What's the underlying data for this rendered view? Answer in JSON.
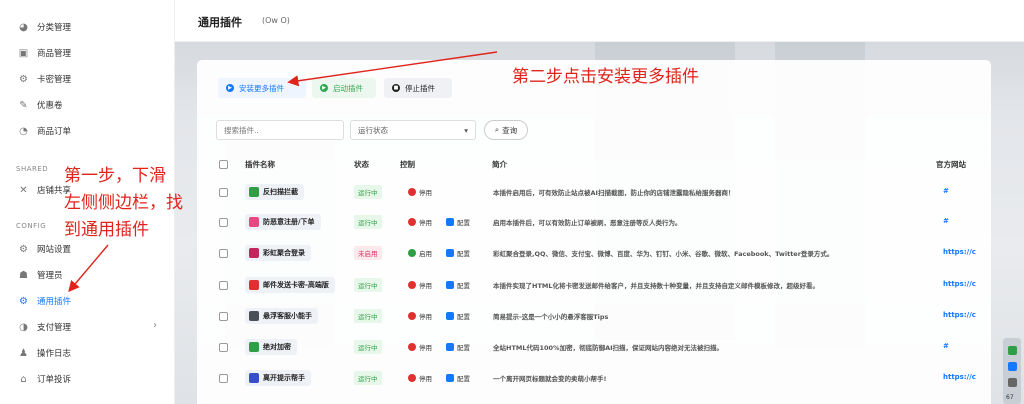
{
  "sidebar": {
    "items_top": [
      {
        "label": "分类管理",
        "icon": "category-icon"
      },
      {
        "label": "商品管理",
        "icon": "goods-icon"
      },
      {
        "label": "卡密管理",
        "icon": "card-key-icon"
      },
      {
        "label": "优惠卷",
        "icon": "coupon-icon"
      },
      {
        "label": "商品订单",
        "icon": "order-icon"
      }
    ],
    "section_shared": "SHARED",
    "shared_item": {
      "label": "店铺共享",
      "icon": "share-icon"
    },
    "section_config": "CONFIG",
    "items_config": [
      {
        "label": "网站设置",
        "icon": "settings-icon"
      },
      {
        "label": "管理员",
        "icon": "admin-icon"
      },
      {
        "label": "通用插件",
        "icon": "plugin-icon"
      },
      {
        "label": "支付管理",
        "icon": "payment-icon"
      },
      {
        "label": "操作日志",
        "icon": "log-icon"
      },
      {
        "label": "订单投诉",
        "icon": "complaint-icon"
      }
    ],
    "active_label": "通用插件"
  },
  "header": {
    "title": "通用插件",
    "subtitle": "(Ow O)"
  },
  "toolbar": {
    "install": "安装更多插件",
    "enable": "启动插件",
    "stop": "停止插件"
  },
  "filters": {
    "search_placeholder": "搜索插件..",
    "status_placeholder": "运行状态",
    "search_button": "查询"
  },
  "table": {
    "columns": {
      "name": "插件名称",
      "status": "状态",
      "control": "控制",
      "desc": "简介",
      "site": "官方网站"
    },
    "control_labels": {
      "disable": "停用",
      "enable": "启用",
      "config": "配置"
    },
    "rows": [
      {
        "name": "反扫描拦截",
        "status": "运行中",
        "running": true,
        "has_config": false,
        "desc": "本插件启用后，可有效防止站点被AI扫描截图，防止你的店铺泄露隐私给服务器商！",
        "site": "#",
        "icon_color": "#2f9e44"
      },
      {
        "name": "防恶意注册/下单",
        "status": "运行中",
        "running": true,
        "has_config": true,
        "desc": "启用本插件后，可以有效防止订单被刷，恶意注册等反人类行为。",
        "site": "#",
        "icon_color": "#e64980"
      },
      {
        "name": "彩虹聚合登录",
        "status": "未启用",
        "running": false,
        "has_config": true,
        "desc": "彩虹聚合登录,QQ、微信、支付宝、微博、百度、华为、钉钉、小米、谷歌、微软、Facebook、Twitter登录方式。",
        "site": "https://c",
        "icon_color": "#c2255c"
      },
      {
        "name": "邮件发送卡密-高端版",
        "status": "运行中",
        "running": true,
        "has_config": true,
        "desc": "本插件实现了HTML化将卡密发送邮件给客户，并且支持数十种变量，并且支持自定义邮件模板修改，超级好看。",
        "site": "https://c",
        "icon_color": "#e03131"
      },
      {
        "name": "悬浮客服小能手",
        "status": "运行中",
        "running": true,
        "has_config": true,
        "desc": "简易提示-这是一个小小的悬浮客服Tips",
        "site": "https://c",
        "icon_color": "#495057"
      },
      {
        "name": "绝对加密",
        "status": "运行中",
        "running": true,
        "has_config": true,
        "desc": "全站HTML代码100%加密，彻底防御AI扫描，保证网站内容绝对无法被扫描。",
        "site": "#",
        "icon_color": "#2f9e44"
      },
      {
        "name": "离开提示帮手",
        "status": "运行中",
        "running": true,
        "has_config": true,
        "desc": "一个离开网页标题就会变的卖萌小帮手!",
        "site": "https://c",
        "icon_color": "#364fc7"
      }
    ]
  },
  "annotations": {
    "step2": "第二步点击安装更多插件",
    "step1_line1": "第一步，下滑",
    "step1_line2": "左侧侧边栏，找",
    "step1_line3": "到通用插件"
  },
  "widget": {
    "number": "67"
  },
  "colors": {
    "accent": "#1677ff",
    "annotation": "#e0241b",
    "running": "#2f9e44",
    "stopped": "#d6336c"
  }
}
